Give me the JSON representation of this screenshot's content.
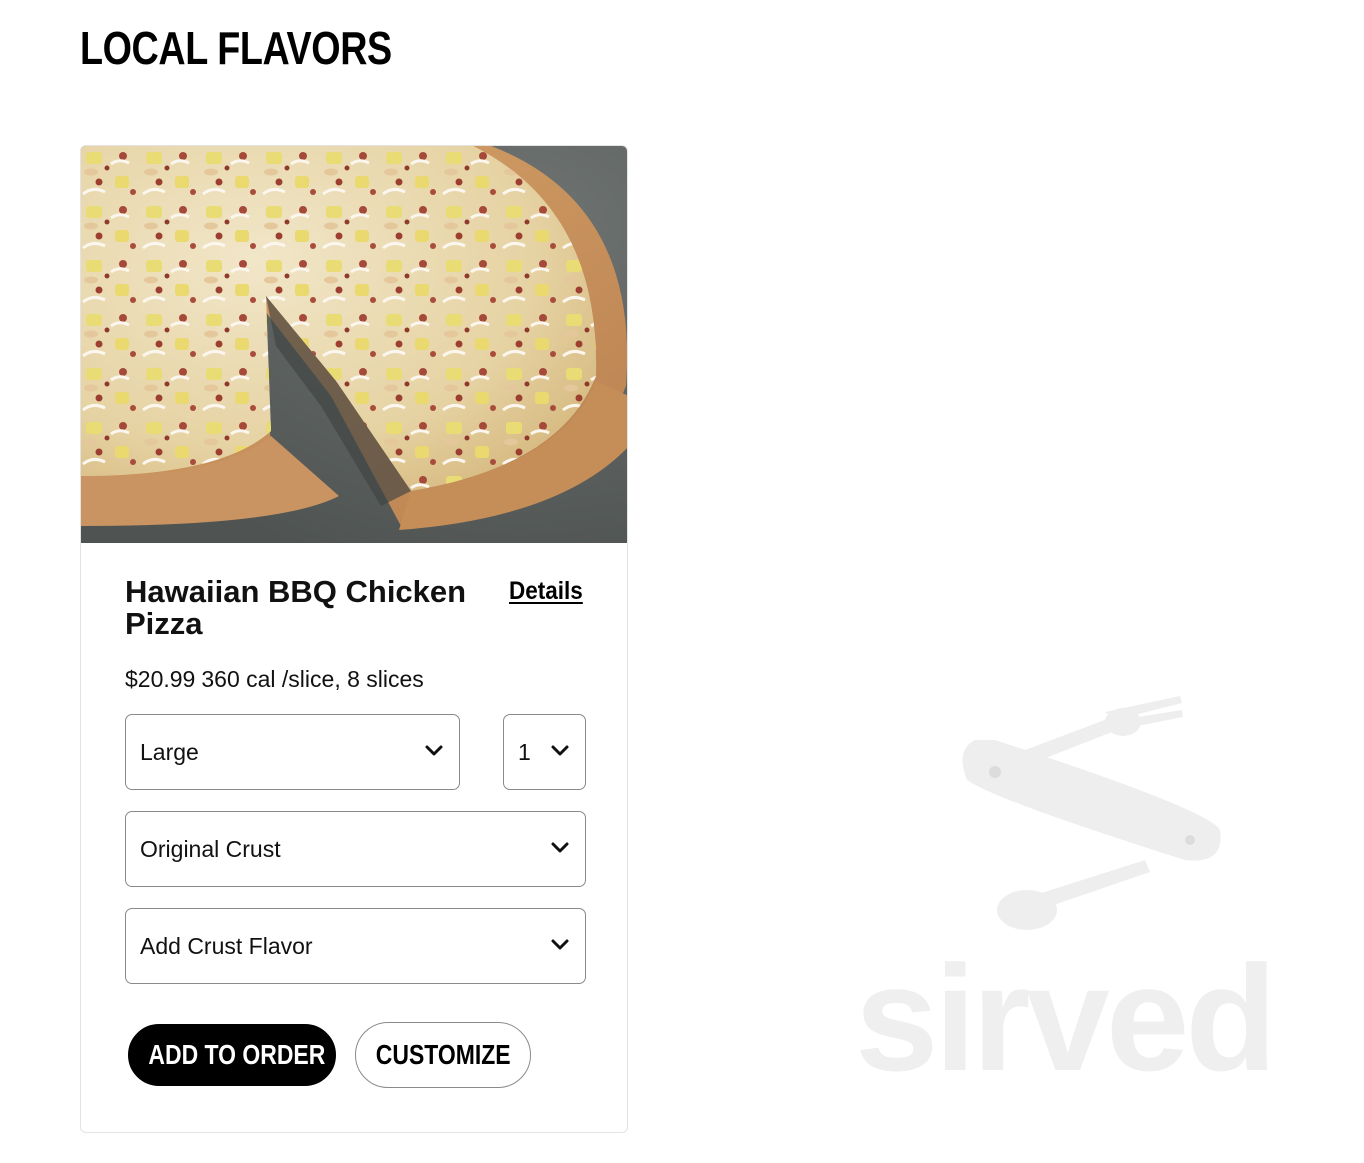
{
  "section": {
    "title": "LOCAL FLAVORS"
  },
  "product": {
    "name": "Hawaiian BBQ Chicken Pizza",
    "details_link": "Details",
    "price": "$20.99",
    "calories": "360 cal /slice, 8 slices",
    "image_icon": "pizza-photo"
  },
  "options": {
    "size": {
      "selected": "Large",
      "icon": "chevron-down-icon"
    },
    "quantity": {
      "selected": "1",
      "icon": "chevron-down-icon"
    },
    "crust": {
      "selected": "Original Crust",
      "icon": "chevron-down-icon"
    },
    "crust_flavor": {
      "selected": "Add Crust Flavor",
      "icon": "chevron-down-icon"
    }
  },
  "actions": {
    "add_to_order": "ADD TO ORDER",
    "customize": "CUSTOMIZE"
  },
  "watermark": {
    "text": "sirved"
  },
  "colors": {
    "primary_button_bg": "#000000",
    "primary_button_text": "#ffffff",
    "border": "#8a8a8a",
    "watermark": "#efefef"
  }
}
